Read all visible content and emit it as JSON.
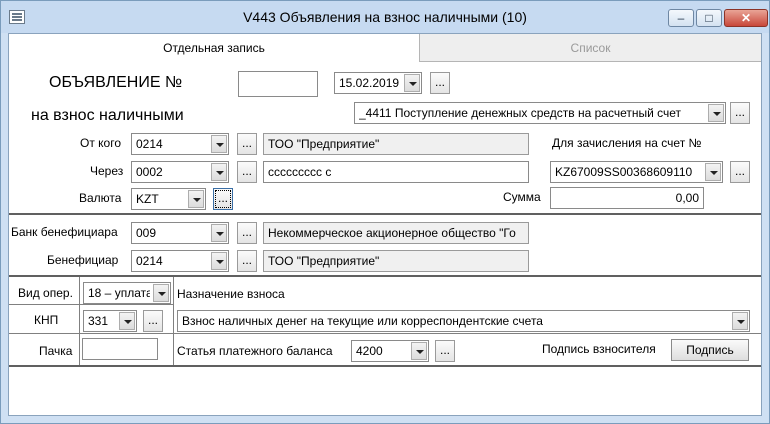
{
  "window": {
    "title": "V443 Объявления на взнос наличными (10)",
    "minimize": "–",
    "maximize": "□",
    "close": "✕"
  },
  "tabs": [
    {
      "label": "Отдельная запись",
      "active": true
    },
    {
      "label": "Список",
      "active": false
    }
  ],
  "header": {
    "doc_title": "ОБЪЯВЛЕНИЕ №",
    "doc_number": "",
    "date": "15.02.2019",
    "subtitle": "на взнос наличными",
    "operation_type": "_4411 Поступление денежных средств на расчетный счет"
  },
  "form": {
    "from_label": "От кого",
    "from_code": "0214",
    "from_name": "ТОО \"Предприятие\"",
    "through_label": "Через",
    "through_code": "0002",
    "through_name": "ссссссссс с",
    "currency_label": "Валюта",
    "currency": "KZT",
    "account_label": "Для зачисления на счет №",
    "account": "KZ67009SS00368609110",
    "sum_label": "Сумма",
    "sum": "0,00",
    "bank_label": "Банк бенефициара",
    "bank_code": "009",
    "bank_name": "Некоммерческое акционерное общество \"Го",
    "beneficiary_label": "Бенефициар",
    "beneficiary_code": "0214",
    "beneficiary_name": "ТОО \"Предприятие\"",
    "op_type_label": "Вид опер.",
    "op_type": "18 – уплата",
    "knp_label": "КНП",
    "knp": "331",
    "purpose_label": "Назначение взноса",
    "purpose": "Взнос наличных денег на текущие или корреспондентские счета",
    "pack_label": "Пачка",
    "pack": "",
    "balance_label": "Статья платежного баланса",
    "balance": "4200",
    "signature_label": "Подпись взносителя",
    "signature_button": "Подпись"
  },
  "ellipsis": "..."
}
